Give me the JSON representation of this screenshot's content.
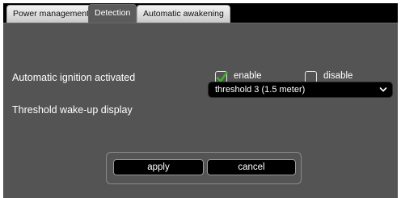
{
  "tabs": [
    {
      "label": "Power management",
      "active": false
    },
    {
      "label": "Detection",
      "active": true
    },
    {
      "label": "Automatic awakening",
      "active": false
    }
  ],
  "ignition": {
    "label": "Automatic ignition activated",
    "enable_label": "enable",
    "enable_checked": true,
    "disable_label": "disable",
    "disable_checked": false
  },
  "threshold": {
    "label": "Threshold wake-up display",
    "selected": "threshold 3 (1.5 meter)",
    "icon": "chevron-down-icon"
  },
  "buttons": {
    "apply_label": "apply",
    "cancel_label": "cancel"
  },
  "colors": {
    "panel": "#545454",
    "check_accent": "#3fae2a",
    "tab_active": "#5b5b5b"
  }
}
